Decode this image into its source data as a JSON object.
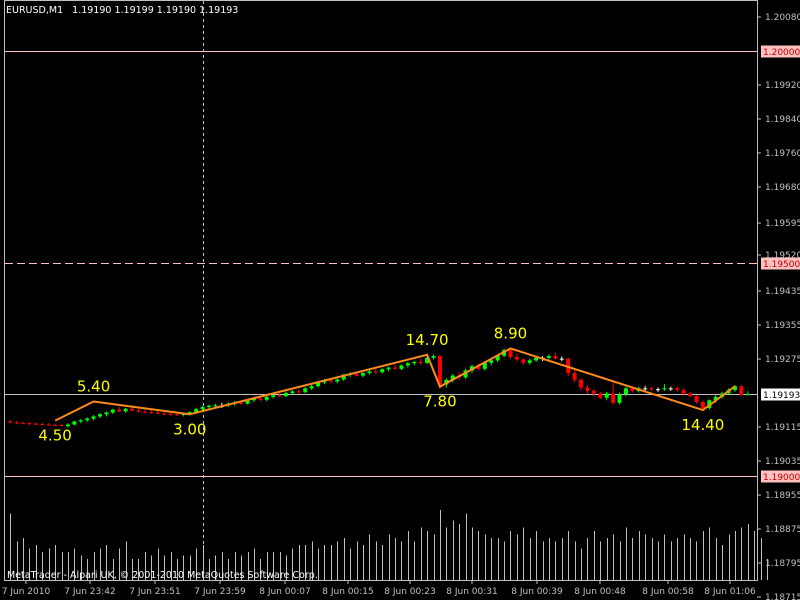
{
  "header": {
    "symbol": "EURUSD,M1",
    "ohlc": "1.19190 1.19199 1.19190 1.19193"
  },
  "footer": {
    "copyright": "MetaTrader - Alpari UK, © 2001-2010 MetaQuotes Software Corp."
  },
  "colors": {
    "background": "#000000",
    "bull_candle": "#00ff00",
    "bear_candle": "#ff0000",
    "doji": "#ffffff",
    "zigzag": "#ff8c1a",
    "zigzag_label": "#ffff00",
    "level_line": "#ffc0c0",
    "bid_line": "#c0c0c0",
    "axis_text": "#c0c0c0",
    "volume": "#c0c0c0"
  },
  "chart_data": {
    "type": "candlestick",
    "y_axis": {
      "min": 1.18755,
      "max": 1.2012,
      "ticks": [
        "1.20080",
        "1.19920",
        "1.19840",
        "1.19760",
        "1.19680",
        "1.19595",
        "1.19520",
        "1.19435",
        "1.19355",
        "1.19275",
        "1.19115",
        "1.19035",
        "1.18955",
        "1.18875",
        "1.18795",
        "1.18715"
      ]
    },
    "x_axis": {
      "labels": [
        "7 Jun 2010",
        "7 Jun 23:42",
        "7 Jun 23:51",
        "7 Jun 23:59",
        "8 Jun 00:07",
        "8 Jun 00:15",
        "8 Jun 00:23",
        "8 Jun 00:31",
        "8 Jun 00:39",
        "8 Jun 00:48",
        "8 Jun 00:58",
        "8 Jun 01:06"
      ]
    },
    "levels": [
      {
        "name": "resistance",
        "value": 1.2,
        "label": "1.20000",
        "style": "solid"
      },
      {
        "name": "middle",
        "value": 1.195,
        "label": "1.19500",
        "style": "dashed"
      },
      {
        "name": "support",
        "value": 1.19,
        "label": "1.19000",
        "style": "solid"
      }
    ],
    "bid": {
      "value": 1.19193,
      "label": "1.19193"
    },
    "zigzag": [
      {
        "price": 1.1913,
        "label": "4.50"
      },
      {
        "price": 1.19175,
        "label": "5.40"
      },
      {
        "price": 1.19145,
        "label": "3.00"
      },
      {
        "price": 1.19285,
        "label": "14.70"
      },
      {
        "price": 1.1921,
        "label": "7.80"
      },
      {
        "price": 1.193,
        "label": "8.90"
      },
      {
        "price": 1.19155,
        "label": "14.40"
      }
    ],
    "candles": [
      {
        "o": 1.19128,
        "h": 1.19132,
        "l": 1.19124,
        "c": 1.19126
      },
      {
        "o": 1.19126,
        "h": 1.1913,
        "l": 1.19122,
        "c": 1.19125
      },
      {
        "o": 1.19125,
        "h": 1.19128,
        "l": 1.19121,
        "c": 1.19124
      },
      {
        "o": 1.19124,
        "h": 1.19127,
        "l": 1.1912,
        "c": 1.19123
      },
      {
        "o": 1.19123,
        "h": 1.19126,
        "l": 1.19119,
        "c": 1.19122
      },
      {
        "o": 1.19122,
        "h": 1.19125,
        "l": 1.19119,
        "c": 1.19121
      },
      {
        "o": 1.19121,
        "h": 1.19124,
        "l": 1.19118,
        "c": 1.1912
      },
      {
        "o": 1.1912,
        "h": 1.19123,
        "l": 1.19117,
        "c": 1.19119
      },
      {
        "o": 1.1912,
        "h": 1.19122,
        "l": 1.19117,
        "c": 1.19118
      },
      {
        "o": 1.19117,
        "h": 1.19124,
        "l": 1.19114,
        "c": 1.19121
      },
      {
        "o": 1.19121,
        "h": 1.1913,
        "l": 1.19119,
        "c": 1.19128
      },
      {
        "o": 1.19128,
        "h": 1.19134,
        "l": 1.19124,
        "c": 1.19131
      },
      {
        "o": 1.19131,
        "h": 1.19138,
        "l": 1.19127,
        "c": 1.19135
      },
      {
        "o": 1.19135,
        "h": 1.19143,
        "l": 1.19131,
        "c": 1.1914
      },
      {
        "o": 1.1914,
        "h": 1.19148,
        "l": 1.19136,
        "c": 1.19145
      },
      {
        "o": 1.19145,
        "h": 1.19152,
        "l": 1.1914,
        "c": 1.19149
      },
      {
        "o": 1.19149,
        "h": 1.19158,
        "l": 1.19146,
        "c": 1.19156
      },
      {
        "o": 1.19156,
        "h": 1.19162,
        "l": 1.1915,
        "c": 1.19152
      },
      {
        "o": 1.19152,
        "h": 1.1916,
        "l": 1.19148,
        "c": 1.19158
      },
      {
        "o": 1.19158,
        "h": 1.19163,
        "l": 1.19151,
        "c": 1.19154
      },
      {
        "o": 1.19154,
        "h": 1.19158,
        "l": 1.19149,
        "c": 1.19151
      },
      {
        "o": 1.19151,
        "h": 1.19156,
        "l": 1.19147,
        "c": 1.1915
      },
      {
        "o": 1.1915,
        "h": 1.19155,
        "l": 1.19146,
        "c": 1.19149
      },
      {
        "o": 1.19149,
        "h": 1.19153,
        "l": 1.19145,
        "c": 1.19147
      },
      {
        "o": 1.19147,
        "h": 1.19152,
        "l": 1.19143,
        "c": 1.19146
      },
      {
        "o": 1.19146,
        "h": 1.1915,
        "l": 1.19142,
        "c": 1.19145
      },
      {
        "o": 1.19145,
        "h": 1.19149,
        "l": 1.19141,
        "c": 1.19144
      },
      {
        "o": 1.19144,
        "h": 1.19149,
        "l": 1.1914,
        "c": 1.19146
      },
      {
        "o": 1.19146,
        "h": 1.19152,
        "l": 1.19142,
        "c": 1.1915
      },
      {
        "o": 1.1915,
        "h": 1.1916,
        "l": 1.19146,
        "c": 1.19157
      },
      {
        "o": 1.19157,
        "h": 1.19165,
        "l": 1.19152,
        "c": 1.19162
      },
      {
        "o": 1.19162,
        "h": 1.19168,
        "l": 1.19158,
        "c": 1.19165
      },
      {
        "o": 1.19165,
        "h": 1.1917,
        "l": 1.1916,
        "c": 1.19166
      },
      {
        "o": 1.19166,
        "h": 1.19172,
        "l": 1.1916,
        "c": 1.19166
      },
      {
        "o": 1.19166,
        "h": 1.19173,
        "l": 1.19162,
        "c": 1.1917
      },
      {
        "o": 1.1917,
        "h": 1.19176,
        "l": 1.19165,
        "c": 1.19172
      },
      {
        "o": 1.19172,
        "h": 1.19177,
        "l": 1.19167,
        "c": 1.1917
      },
      {
        "o": 1.1917,
        "h": 1.1918,
        "l": 1.19168,
        "c": 1.19178
      },
      {
        "o": 1.19178,
        "h": 1.19185,
        "l": 1.19174,
        "c": 1.19182
      },
      {
        "o": 1.19182,
        "h": 1.19186,
        "l": 1.19176,
        "c": 1.19179
      },
      {
        "o": 1.19179,
        "h": 1.19188,
        "l": 1.19176,
        "c": 1.19186
      },
      {
        "o": 1.19186,
        "h": 1.19193,
        "l": 1.19182,
        "c": 1.1919
      },
      {
        "o": 1.1919,
        "h": 1.19195,
        "l": 1.19185,
        "c": 1.19188
      },
      {
        "o": 1.19188,
        "h": 1.19198,
        "l": 1.19185,
        "c": 1.19195
      },
      {
        "o": 1.19195,
        "h": 1.19202,
        "l": 1.19191,
        "c": 1.19199
      },
      {
        "o": 1.19199,
        "h": 1.19204,
        "l": 1.19193,
        "c": 1.19197
      },
      {
        "o": 1.19197,
        "h": 1.19209,
        "l": 1.19195,
        "c": 1.19206
      },
      {
        "o": 1.19206,
        "h": 1.19214,
        "l": 1.19202,
        "c": 1.19211
      },
      {
        "o": 1.19211,
        "h": 1.19222,
        "l": 1.19208,
        "c": 1.1922
      },
      {
        "o": 1.1922,
        "h": 1.19228,
        "l": 1.19216,
        "c": 1.19225
      },
      {
        "o": 1.19225,
        "h": 1.1923,
        "l": 1.19219,
        "c": 1.19222
      },
      {
        "o": 1.19222,
        "h": 1.19229,
        "l": 1.19218,
        "c": 1.19227
      },
      {
        "o": 1.19227,
        "h": 1.1924,
        "l": 1.19224,
        "c": 1.19238
      },
      {
        "o": 1.19238,
        "h": 1.19244,
        "l": 1.19233,
        "c": 1.1924
      },
      {
        "o": 1.1924,
        "h": 1.19246,
        "l": 1.19234,
        "c": 1.19236
      },
      {
        "o": 1.19236,
        "h": 1.19244,
        "l": 1.19232,
        "c": 1.19242
      },
      {
        "o": 1.19242,
        "h": 1.19249,
        "l": 1.19238,
        "c": 1.19246
      },
      {
        "o": 1.19246,
        "h": 1.19252,
        "l": 1.1924,
        "c": 1.19244
      },
      {
        "o": 1.19244,
        "h": 1.19253,
        "l": 1.19241,
        "c": 1.19251
      },
      {
        "o": 1.19251,
        "h": 1.19257,
        "l": 1.19246,
        "c": 1.19255
      },
      {
        "o": 1.19255,
        "h": 1.19262,
        "l": 1.1925,
        "c": 1.19252
      },
      {
        "o": 1.19252,
        "h": 1.19262,
        "l": 1.19249,
        "c": 1.1926
      },
      {
        "o": 1.1926,
        "h": 1.19268,
        "l": 1.19255,
        "c": 1.19265
      },
      {
        "o": 1.19265,
        "h": 1.19271,
        "l": 1.1926,
        "c": 1.19268
      },
      {
        "o": 1.19268,
        "h": 1.19275,
        "l": 1.19262,
        "c": 1.19266
      },
      {
        "o": 1.19266,
        "h": 1.1928,
        "l": 1.19263,
        "c": 1.19278
      },
      {
        "o": 1.19278,
        "h": 1.19286,
        "l": 1.19274,
        "c": 1.19282
      },
      {
        "o": 1.19282,
        "h": 1.19285,
        "l": 1.19205,
        "c": 1.19215
      },
      {
        "o": 1.19215,
        "h": 1.1923,
        "l": 1.19208,
        "c": 1.19226
      },
      {
        "o": 1.19226,
        "h": 1.1924,
        "l": 1.1922,
        "c": 1.19236
      },
      {
        "o": 1.19236,
        "h": 1.19244,
        "l": 1.19226,
        "c": 1.19232
      },
      {
        "o": 1.19232,
        "h": 1.19252,
        "l": 1.19228,
        "c": 1.19248
      },
      {
        "o": 1.19248,
        "h": 1.19262,
        "l": 1.19242,
        "c": 1.19258
      },
      {
        "o": 1.19258,
        "h": 1.19264,
        "l": 1.19248,
        "c": 1.19252
      },
      {
        "o": 1.19252,
        "h": 1.1927,
        "l": 1.19248,
        "c": 1.19266
      },
      {
        "o": 1.19266,
        "h": 1.19276,
        "l": 1.1926,
        "c": 1.19272
      },
      {
        "o": 1.19272,
        "h": 1.19286,
        "l": 1.19268,
        "c": 1.19283
      },
      {
        "o": 1.19283,
        "h": 1.193,
        "l": 1.19279,
        "c": 1.19296
      },
      {
        "o": 1.19296,
        "h": 1.193,
        "l": 1.19276,
        "c": 1.1928
      },
      {
        "o": 1.1928,
        "h": 1.19288,
        "l": 1.1927,
        "c": 1.19274
      },
      {
        "o": 1.19274,
        "h": 1.19278,
        "l": 1.19262,
        "c": 1.19266
      },
      {
        "o": 1.19266,
        "h": 1.19276,
        "l": 1.19262,
        "c": 1.19272
      },
      {
        "o": 1.19272,
        "h": 1.19282,
        "l": 1.19268,
        "c": 1.19278
      },
      {
        "o": 1.19278,
        "h": 1.19282,
        "l": 1.1927,
        "c": 1.19278
      },
      {
        "o": 1.19278,
        "h": 1.19286,
        "l": 1.19274,
        "c": 1.19282
      },
      {
        "o": 1.19282,
        "h": 1.1929,
        "l": 1.19274,
        "c": 1.19276
      },
      {
        "o": 1.19276,
        "h": 1.19281,
        "l": 1.1927,
        "c": 1.19276
      },
      {
        "o": 1.19276,
        "h": 1.19278,
        "l": 1.19235,
        "c": 1.19242
      },
      {
        "o": 1.19242,
        "h": 1.1925,
        "l": 1.1922,
        "c": 1.19226
      },
      {
        "o": 1.19226,
        "h": 1.1923,
        "l": 1.19202,
        "c": 1.19208
      },
      {
        "o": 1.19208,
        "h": 1.19214,
        "l": 1.19194,
        "c": 1.192
      },
      {
        "o": 1.192,
        "h": 1.19204,
        "l": 1.19188,
        "c": 1.19194
      },
      {
        "o": 1.19194,
        "h": 1.19198,
        "l": 1.1918,
        "c": 1.19184
      },
      {
        "o": 1.19184,
        "h": 1.19198,
        "l": 1.19178,
        "c": 1.19194
      },
      {
        "o": 1.19194,
        "h": 1.1922,
        "l": 1.19168,
        "c": 1.19172
      },
      {
        "o": 1.19172,
        "h": 1.19196,
        "l": 1.19168,
        "c": 1.19192
      },
      {
        "o": 1.19192,
        "h": 1.1921,
        "l": 1.19188,
        "c": 1.19206
      },
      {
        "o": 1.19206,
        "h": 1.19212,
        "l": 1.19196,
        "c": 1.192
      },
      {
        "o": 1.192,
        "h": 1.1921,
        "l": 1.19196,
        "c": 1.19206
      },
      {
        "o": 1.19206,
        "h": 1.19212,
        "l": 1.192,
        "c": 1.19206
      },
      {
        "o": 1.19206,
        "h": 1.1921,
        "l": 1.192,
        "c": 1.19204
      },
      {
        "o": 1.19204,
        "h": 1.19208,
        "l": 1.19198,
        "c": 1.19204
      },
      {
        "o": 1.19204,
        "h": 1.19216,
        "l": 1.192,
        "c": 1.19206
      },
      {
        "o": 1.19206,
        "h": 1.1921,
        "l": 1.192,
        "c": 1.19206
      },
      {
        "o": 1.19206,
        "h": 1.1921,
        "l": 1.19198,
        "c": 1.19202
      },
      {
        "o": 1.19202,
        "h": 1.19206,
        "l": 1.1919,
        "c": 1.19194
      },
      {
        "o": 1.19194,
        "h": 1.19198,
        "l": 1.19184,
        "c": 1.19188
      },
      {
        "o": 1.19188,
        "h": 1.1919,
        "l": 1.1917,
        "c": 1.19174
      },
      {
        "o": 1.19174,
        "h": 1.19178,
        "l": 1.19155,
        "c": 1.1916
      },
      {
        "o": 1.1916,
        "h": 1.1918,
        "l": 1.19156,
        "c": 1.19178
      },
      {
        "o": 1.19178,
        "h": 1.1919,
        "l": 1.19172,
        "c": 1.19186
      },
      {
        "o": 1.19186,
        "h": 1.19198,
        "l": 1.19182,
        "c": 1.19194
      },
      {
        "o": 1.19194,
        "h": 1.19206,
        "l": 1.1919,
        "c": 1.19202
      },
      {
        "o": 1.19202,
        "h": 1.19214,
        "l": 1.19198,
        "c": 1.19211
      },
      {
        "o": 1.19211,
        "h": 1.19214,
        "l": 1.19188,
        "c": 1.1919
      },
      {
        "o": 1.1919,
        "h": 1.19199,
        "l": 1.1919,
        "c": 1.19193
      }
    ],
    "volume_scale": "relative",
    "volumes": [
      0.95,
      0.55,
      0.6,
      0.45,
      0.5,
      0.4,
      0.45,
      0.5,
      0.4,
      0.4,
      0.45,
      0.35,
      0.3,
      0.4,
      0.45,
      0.5,
      0.3,
      0.45,
      0.55,
      0.3,
      0.3,
      0.4,
      0.35,
      0.45,
      0.35,
      0.4,
      0.3,
      0.35,
      0.35,
      0.45,
      0.5,
      0.3,
      0.35,
      0.4,
      0.3,
      0.4,
      0.35,
      0.4,
      0.45,
      0.3,
      0.4,
      0.4,
      0.4,
      0.35,
      0.45,
      0.5,
      0.5,
      0.55,
      0.45,
      0.5,
      0.5,
      0.55,
      0.6,
      0.45,
      0.55,
      0.5,
      0.65,
      0.55,
      0.5,
      0.65,
      0.6,
      0.55,
      0.7,
      0.55,
      0.75,
      0.7,
      0.65,
      1.0,
      0.75,
      0.85,
      0.8,
      0.95,
      0.75,
      0.7,
      0.65,
      0.6,
      0.6,
      0.55,
      0.7,
      0.65,
      0.75,
      0.6,
      0.7,
      0.55,
      0.6,
      0.55,
      0.6,
      0.7,
      0.55,
      0.45,
      0.6,
      0.7,
      0.55,
      0.6,
      0.65,
      0.55,
      0.75,
      0.6,
      0.7,
      0.65,
      0.6,
      0.55,
      0.65,
      0.55,
      0.6,
      0.65,
      0.6,
      0.55,
      0.7,
      0.75,
      0.6,
      0.5,
      0.65,
      0.7,
      0.75,
      0.8,
      0.7,
      0.6,
      0.3
    ]
  }
}
